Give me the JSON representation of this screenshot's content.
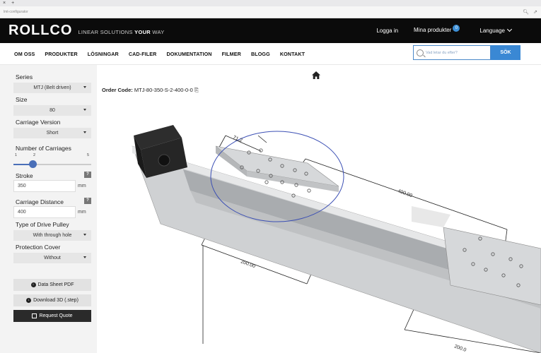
{
  "browser": {
    "tab_close": "×",
    "tab_new": "+",
    "url": "lmt-configurator"
  },
  "header": {
    "logo": "ROLLCO",
    "tagline_prefix": "LINEAR SOLUTIONS ",
    "tagline_bold": "YOUR",
    "tagline_suffix": " WAY",
    "login": "Logga in",
    "my_products": "Mina produkter",
    "cart_count": "0",
    "language": "Language"
  },
  "nav": {
    "items": [
      "OM OSS",
      "PRODUKTER",
      "LÖSNINGAR",
      "CAD-FILER",
      "DOKUMENTATION",
      "FILMER",
      "BLOGG",
      "KONTAKT"
    ],
    "search_placeholder": "Vad letar du efter?",
    "search_button": "SÖK"
  },
  "sidebar": {
    "series_label": "Series",
    "series_value": "MTJ (Belt driven)",
    "size_label": "Size",
    "size_value": "80",
    "carriage_version_label": "Carriage Version",
    "carriage_version_value": "Short",
    "carriages_label": "Number of Carriages",
    "carriages_ticks": [
      "1",
      "2",
      "5"
    ],
    "carriages_min": 1,
    "carriages_max": 5,
    "carriages_value": 2,
    "stroke_label": "Stroke",
    "stroke_value": "350",
    "stroke_unit": "mm",
    "carriage_distance_label": "Carriage Distance",
    "carriage_distance_value": "400",
    "carriage_distance_unit": "mm",
    "help": "?",
    "drive_pulley_label": "Type of Drive Pulley",
    "drive_pulley_value": "With through hole",
    "protection_label": "Protection Cover",
    "protection_value": "Without",
    "datasheet_button": "Data Sheet PDF",
    "download3d_button": "Download 3D (.step)",
    "quote_button": "Request Quote"
  },
  "content": {
    "order_code_label": "Order Code:",
    "order_code_value": "MTJ-80-350-S-2-400-0-0",
    "dims": {
      "a": "71.2",
      "b": "400.00",
      "c": "200.00",
      "d": "200.0"
    }
  },
  "colors": {
    "header_bg": "#0b0b0b",
    "accent": "#3a88d4",
    "slider": "#4a6fb8",
    "quote_bg": "#2a2a2a"
  }
}
